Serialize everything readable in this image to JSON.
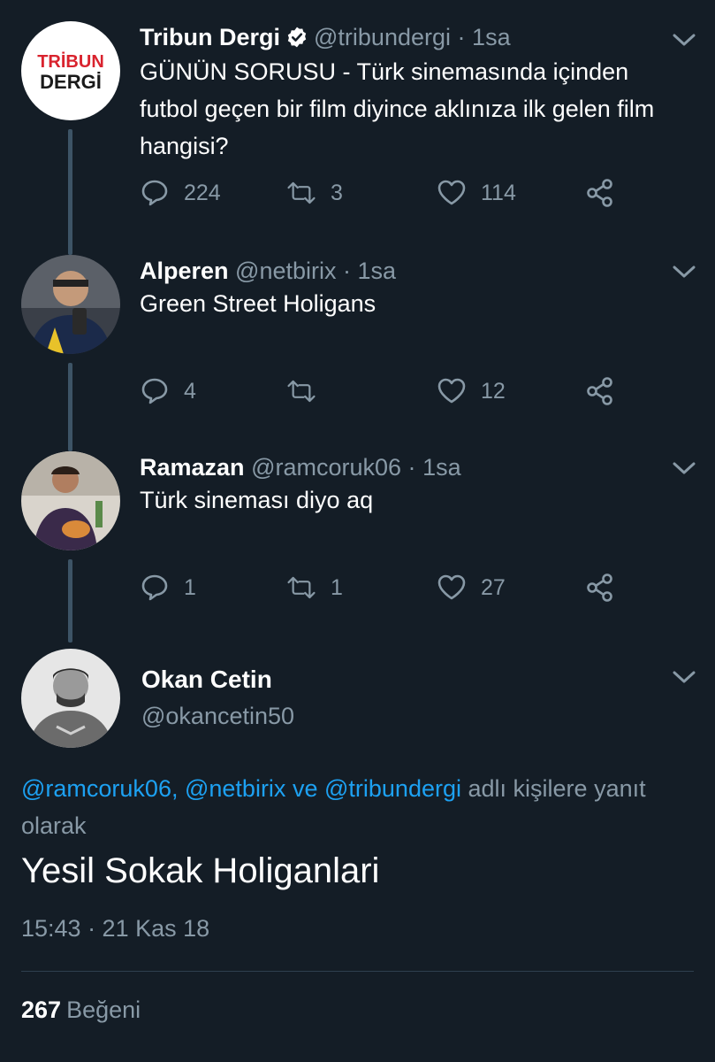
{
  "tweets": [
    {
      "name": "Tribun Dergi",
      "handle": "@tribundergi",
      "sep": "·",
      "time": "1sa",
      "verified": true,
      "avatar_text_top": "TRİBUN",
      "avatar_text_bottom": "DERGİ",
      "text": "GÜNÜN SORUSU - Türk sinemasında içinden futbol geçen bir film diyince aklınıza ilk gelen film hangisi?",
      "replies": "224",
      "retweets": "3",
      "likes": "114"
    },
    {
      "name": "Alperen",
      "handle": "@netbirix",
      "sep": "·",
      "time": "1sa",
      "text": "Green Street Holigans",
      "replies": "4",
      "retweets": "",
      "likes": "12"
    },
    {
      "name": "Ramazan",
      "handle": "@ramcoruk06",
      "sep": "·",
      "time": "1sa",
      "text": "Türk sineması diyo aq",
      "replies": "1",
      "retweets": "1",
      "likes": "27"
    }
  ],
  "main": {
    "name": "Okan Cetin",
    "handle": "@okancetin50",
    "reply_mentions": [
      "@ramcoruk06,",
      "@netbirix",
      "ve",
      "@tribundergi"
    ],
    "reply_suffix": "adlı kişilere yanıt olarak",
    "text": "Yesil Sokak Holiganlari",
    "timestamp": "15:43 · 21 Kas 18",
    "like_count": "267",
    "like_label": "Beğeni"
  },
  "colors": {
    "background": "#141d26",
    "secondary_text": "#8899a6",
    "link": "#1da1f2",
    "thread_line": "#3d5466"
  },
  "icons": [
    "verified-badge-icon",
    "chevron-down-icon",
    "reply-icon",
    "retweet-icon",
    "like-icon",
    "share-icon"
  ]
}
